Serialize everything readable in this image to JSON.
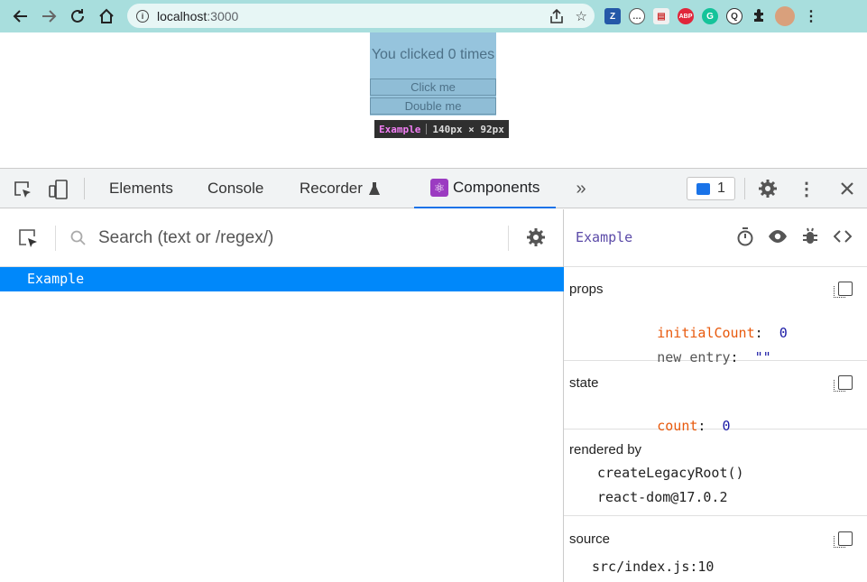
{
  "browser": {
    "url_host": "localhost",
    "url_port": ":3000",
    "extensions": [
      {
        "name": "zotero-extension-icon",
        "label": "Z",
        "color": "#2458a8"
      },
      {
        "name": "page-extension-icon",
        "label": "…",
        "color": "#777777"
      },
      {
        "name": "doc-extension-icon",
        "label": "▤",
        "color": "#b0b0b0"
      },
      {
        "name": "adblock-extension-icon",
        "label": "ABP",
        "color": "#e0263b"
      },
      {
        "name": "grammarly-extension-icon",
        "label": "G",
        "color": "#15c39a"
      },
      {
        "name": "wappalyzer-extension-icon",
        "label": "Q",
        "color": "#3b3b3b"
      }
    ]
  },
  "page": {
    "counter_text": "You clicked 0 times",
    "click_button": "Click me",
    "double_button": "Double me",
    "tooltip_name": "Example",
    "tooltip_size": "140px × 92px"
  },
  "devtools": {
    "tabs": {
      "elements": "Elements",
      "console": "Console",
      "recorder": "Recorder",
      "components": "Components"
    },
    "message_count": "1"
  },
  "components": {
    "search_placeholder": "Search (text or /regex/)",
    "tree": [
      "Example"
    ]
  },
  "inspector": {
    "component_name": "Example",
    "props_title": "props",
    "props": [
      {
        "key": "initialCount",
        "value": "0"
      },
      {
        "key": "new entry",
        "value": "\"\""
      }
    ],
    "state_title": "state",
    "state": [
      {
        "key": "count",
        "value": "0"
      }
    ],
    "rendered_by_title": "rendered by",
    "rendered_by": [
      "createLegacyRoot()",
      "react-dom@17.0.2"
    ],
    "source_title": "source",
    "source": "src/index.js:10"
  }
}
